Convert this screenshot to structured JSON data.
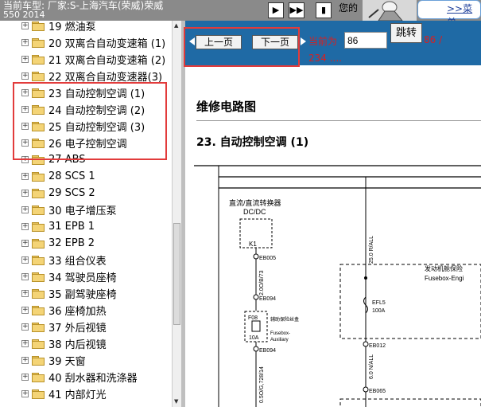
{
  "header": {
    "model_line1": "当前车型: 厂家:S-上海汽车(荣威)荣威",
    "model_line2": "550 2014",
    "hello": "您的",
    "menu_link": ">>菜单"
  },
  "nav_icons": [
    "play-icon",
    "fast-forward-icon",
    "step-icon"
  ],
  "tree": {
    "items": [
      {
        "label": "19 燃油泵"
      },
      {
        "label": "20 双离合自动变速箱 (1)"
      },
      {
        "label": "21 双离合自动变速箱 (2)"
      },
      {
        "label": "22 双离合自动变速器(3)"
      },
      {
        "label": "23 自动控制空调 (1)"
      },
      {
        "label": "24 自动控制空调 (2)"
      },
      {
        "label": "25 自动控制空调 (3)"
      },
      {
        "label": "26 电子控制空调"
      },
      {
        "label": "27 ABS"
      },
      {
        "label": "28 SCS 1"
      },
      {
        "label": "29 SCS 2"
      },
      {
        "label": "30 电子增压泵"
      },
      {
        "label": "31 EPB 1"
      },
      {
        "label": "32 EPB 2"
      },
      {
        "label": "33 组合仪表"
      },
      {
        "label": "34 驾驶员座椅"
      },
      {
        "label": "35 副驾驶座椅"
      },
      {
        "label": "36 座椅加热"
      },
      {
        "label": "37 外后视镜"
      },
      {
        "label": "38 内后视镜"
      },
      {
        "label": "39 天窗"
      },
      {
        "label": "40 刮水器和洗涤器"
      },
      {
        "label": "41 内部灯光"
      }
    ]
  },
  "pager": {
    "prev_label": "上一页",
    "next_label": "下一页",
    "current_label": "当前为",
    "current_value": "86",
    "jump_label": "跳转",
    "page_count": "86 /",
    "total": "234 ...."
  },
  "document": {
    "title": "维修电路图",
    "section": "23. 自动控制空调 (1)",
    "diagram": {
      "converter_label": "直流/直流转换器",
      "converter_sub": "DC/DC",
      "k1": "K1",
      "eb005": "EB005",
      "wire1": "2.0O/B/73",
      "eb094_a": "EB094",
      "fuse_label": "辅助保险丝盒",
      "fuse_sub1": "Fusebox-",
      "fuse_sub2": "Auxiliary",
      "f08": "F08",
      "f08_amp": "10A",
      "eb094_b": "EB094",
      "wire2": "0.5O/G,728/14",
      "wire3": "25.0 R/ALL",
      "engine_box": "发动机舱保险",
      "engine_box_en": "Fusebox-Engi",
      "efl5": "EFL5",
      "efl5_amp": "100A",
      "eb012": "EB012",
      "wire4": "6.0 N/ALL",
      "eb065": "EB065"
    }
  },
  "colors": {
    "toolbar": "#1f6aa5",
    "highlight": "#e23b3b",
    "red_text": "#d82020"
  }
}
